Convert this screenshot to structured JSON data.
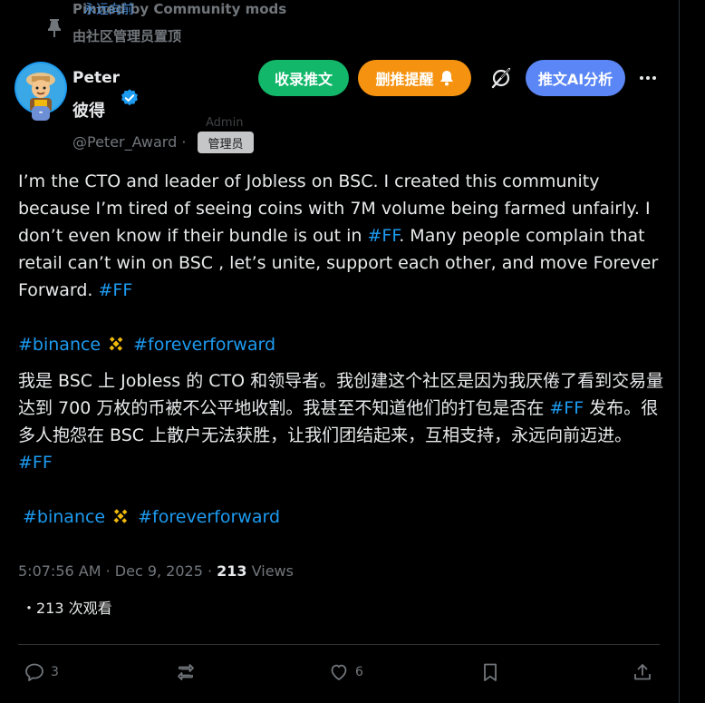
{
  "pinned": {
    "line1": "Pinned by Community mods",
    "overlay": "永远向前",
    "line2": "由社区管理员置顶"
  },
  "author": {
    "name": "Peter",
    "name_cn": "彼得",
    "handle": "@Peter_Award",
    "separator": "·",
    "role_en": "Admin",
    "role_cn": "管理员",
    "avatar_badge": "-"
  },
  "buttons": {
    "save": "收录推文",
    "delete_reminder": "删推提醒",
    "ai": "推文AI分析"
  },
  "post": {
    "p1_a": "I’m the CTO and leader of Jobless on BSC. I created this community because I’m tired of seeing coins with 7M volume being farmed unfairly. I don’t even know if their bundle is out in ",
    "tag_ff": "#FF",
    "p1_b": ". Many people complain that retail can’t win on BSC , let’s unite, support each other, and move Forever Forward. ",
    "tag_binance": "#binance",
    "tag_foreverforward": "#foreverforward",
    "p2_a": "我是 BSC 上 Jobless 的 CTO 和领导者。我创建这个社区是因为我厌倦了看到交易量达到 700 万枚的币被不公平地收割。我甚至不知道他们的打包是否在 ",
    "p2_b": " 发布。很多人抱怨在 BSC 上散户无法获胜，让我们团结起来，互相支持，永远向前迈进。 "
  },
  "meta": {
    "time": "5:07:56 AM · Dec 9, 2025 · ",
    "views_count": "213",
    "views_label": " Views",
    "cn_views": "・213 次观看"
  },
  "actions": {
    "replies": "3",
    "likes": "6"
  },
  "colors": {
    "link": "#1d9bf0",
    "save_btn": "#12b76a",
    "delete_btn": "#f59311",
    "ai_btn": "#5b86f5",
    "binance": "#f0b90b"
  }
}
